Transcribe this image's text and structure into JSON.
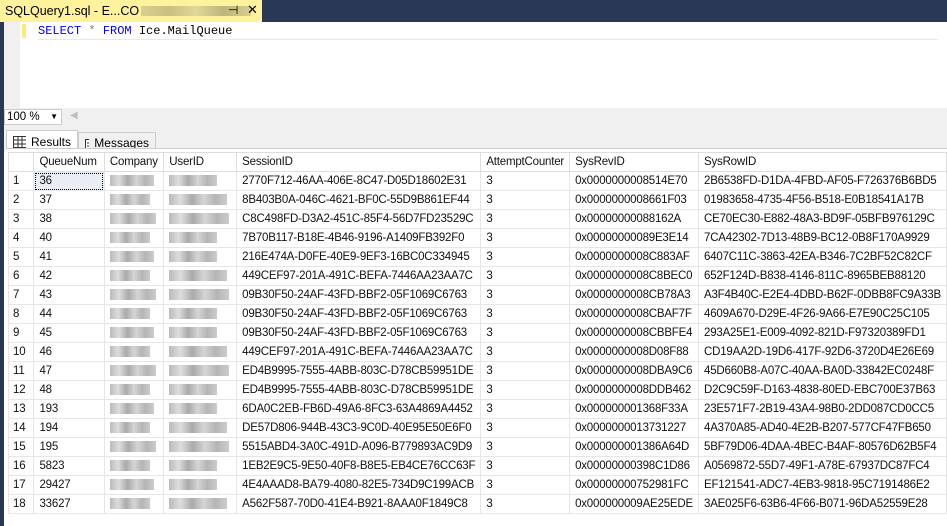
{
  "tab": {
    "title": "SQLQuery1.sql - E...CO",
    "pin": "⊣",
    "close": "✕"
  },
  "query": {
    "select": "SELECT",
    "star": "*",
    "from": "FROM",
    "table": "Ice.MailQueue"
  },
  "zoom": {
    "value": "100 %"
  },
  "result_tabs": [
    {
      "label": "Results"
    },
    {
      "label": "Messages"
    }
  ],
  "columns": [
    "",
    "QueueNum",
    "Company",
    "UserID",
    "SessionID",
    "AttemptCounter",
    "SysRevID",
    "SysRowID"
  ],
  "rows": [
    [
      "1",
      "36",
      "2770F712-46AA-406E-8C47-D05D18602E31",
      "3",
      "0x0000000008514E70",
      "2B6538FD-D1DA-4FBD-AF05-F726376B6BD5"
    ],
    [
      "2",
      "37",
      "8B403B0A-046C-4621-BF0C-55D9B861EF44",
      "3",
      "0x0000000008661F03",
      "01983658-4735-4F56-B518-E0B18541A17B"
    ],
    [
      "3",
      "38",
      "C8C498FD-D3A2-451C-85F4-56D7FD23529C",
      "3",
      "0x00000000088162A",
      "CE70EC30-E882-48A3-BD9F-05BFB976129C"
    ],
    [
      "4",
      "40",
      "7B70B117-B18E-4B46-9196-A1409FB392F0",
      "3",
      "0x00000000089E3E14",
      "7CA42302-7D13-48B9-BC12-0B8F170A9929"
    ],
    [
      "5",
      "41",
      "216E474A-D0FE-40E9-9EF3-16BC0C334945",
      "3",
      "0x0000000008C883AF",
      "6407C11C-3863-42EA-B346-7C2BF52C82CF"
    ],
    [
      "6",
      "42",
      "449CEF97-201A-491C-BEFA-7446AA23AA7C",
      "3",
      "0x0000000008C8BEC0",
      "652F124D-B838-4146-811C-8965BEB88120"
    ],
    [
      "7",
      "43",
      "09B30F50-24AF-43FD-BBF2-05F1069C6763",
      "3",
      "0x0000000008CB78A3",
      "A3F4B40C-E2E4-4DBD-B62F-0DBB8FC9A33B"
    ],
    [
      "8",
      "44",
      "09B30F50-24AF-43FD-BBF2-05F1069C6763",
      "3",
      "0x0000000008CBAF7F",
      "4609A670-D29E-4F26-9A66-E7E90C25C105"
    ],
    [
      "9",
      "45",
      "09B30F50-24AF-43FD-BBF2-05F1069C6763",
      "3",
      "0x0000000008CBBFE4",
      "293A25E1-E009-4092-821D-F97320389FD1"
    ],
    [
      "10",
      "46",
      "449CEF97-201A-491C-BEFA-7446AA23AA7C",
      "3",
      "0x0000000008D08F88",
      "CD19AA2D-19D6-417F-92D6-3720D4E26E69"
    ],
    [
      "11",
      "47",
      "ED4B9995-7555-4ABB-803C-D78CB59951DE",
      "3",
      "0x0000000008DBA9C6",
      "45D660B8-A07C-40AA-BA0D-33842EC0248F"
    ],
    [
      "12",
      "48",
      "ED4B9995-7555-4ABB-803C-D78CB59951DE",
      "3",
      "0x0000000008DDB462",
      "D2C9C59F-D163-4838-80ED-EBC700E37B63"
    ],
    [
      "13",
      "193",
      "6DA0C2EB-FB6D-49A6-8FC3-63A4869A4452",
      "3",
      "0x000000001368F33A",
      "23E571F7-2B19-43A4-98B0-2DD087CD0CC5"
    ],
    [
      "14",
      "194",
      "DE57D806-944B-43C3-9C0D-40E95E50E6F0",
      "3",
      "0x0000000013731227",
      "4A370A85-AD40-4E2B-B207-577CF47FB650"
    ],
    [
      "15",
      "195",
      "5515ABD4-3A0C-491D-A096-B779893AC9D9",
      "3",
      "0x000000001386A64D",
      "5BF79D06-4DAA-4BEC-B4AF-80576D62B5F4"
    ],
    [
      "16",
      "5823",
      "1EB2E9C5-9E50-40F8-B8E5-EB4CE76CC63F",
      "3",
      "0x00000000398C1D86",
      "A0569872-55D7-49F1-A78E-67937DC87FC4"
    ],
    [
      "17",
      "29427",
      "4E4AAAD8-BA79-4080-82E5-734D9C199ACB",
      "3",
      "0x00000000752981FC",
      "EF121541-ADC7-4EB3-9818-95C7191486E2"
    ],
    [
      "18",
      "33627",
      "A562F587-70D0-41E4-B921-8AAA0F1849C8",
      "3",
      "0x000000009AE25EDE",
      "3AE025F6-63B6-4F66-B071-96DA52559E28"
    ]
  ]
}
